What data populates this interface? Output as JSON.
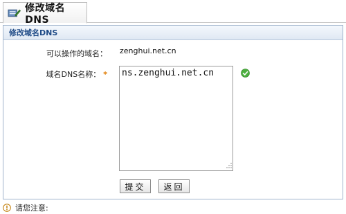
{
  "tab": {
    "title": "修改域名DNS",
    "icon": "edit-icon"
  },
  "panel": {
    "header": "修改域名DNS"
  },
  "form": {
    "domain_label": "可以操作的域名：",
    "domain_value": "zenghui.net.cn",
    "dns_label": "域名DNS名称：",
    "required_mark": "*",
    "dns_value": "ns.zenghui.net.cn"
  },
  "buttons": {
    "submit": "提交",
    "back": "返回"
  },
  "notice": {
    "text": "请您注意:",
    "icon": "info-icon"
  },
  "colors": {
    "accent": "#1e4a86",
    "ok": "#4caf3f",
    "required": "#e07b00"
  }
}
